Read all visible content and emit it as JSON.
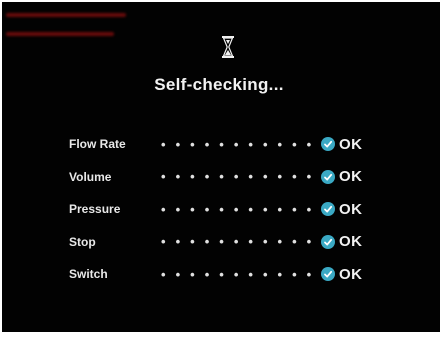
{
  "screen": {
    "title": "Self-checking...",
    "hourglass_icon": "hourglass-icon",
    "accent_color": "#3aa9c4",
    "background_color": "#020202"
  },
  "checks": [
    {
      "label": "Flow Rate",
      "dots": "• • • • • • • • • • •",
      "status": "OK",
      "icon": "check-icon"
    },
    {
      "label": "Volume",
      "dots": "• • • • • • • • • • •",
      "status": "OK",
      "icon": "check-icon"
    },
    {
      "label": "Pressure",
      "dots": "• • • • • • • • • • •",
      "status": "OK",
      "icon": "check-icon"
    },
    {
      "label": "Stop",
      "dots": "• • • • • • • • • • •",
      "status": "OK",
      "icon": "check-icon"
    },
    {
      "label": "Switch",
      "dots": "• • • • • • • • • • •",
      "status": "OK",
      "icon": "check-icon"
    }
  ]
}
